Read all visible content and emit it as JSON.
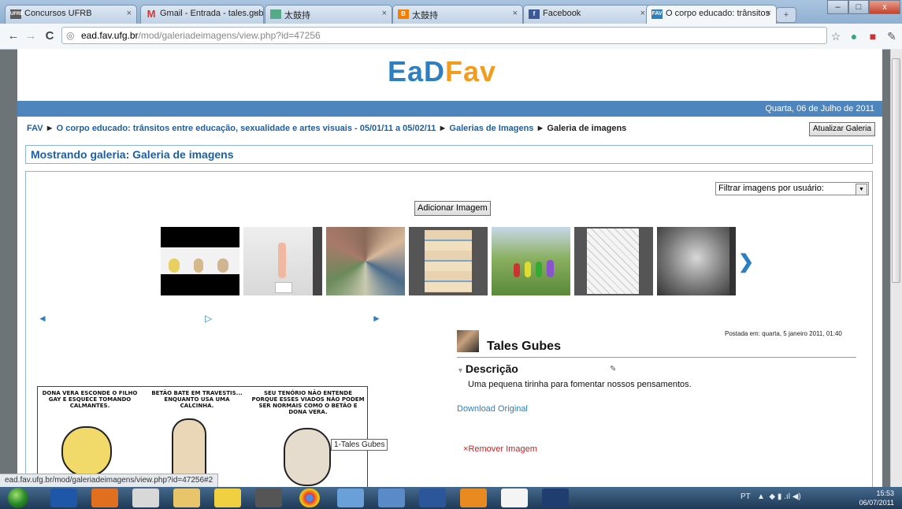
{
  "browser": {
    "tabs": [
      {
        "title": "Concursos UFRB",
        "icon": "ufrb-favicon",
        "active": false
      },
      {
        "title": "Gmail - Entrada - tales.gub",
        "icon": "gmail-favicon",
        "active": false
      },
      {
        "title": "太鼓持",
        "icon": "image-favicon",
        "active": false
      },
      {
        "title": "太鼓持",
        "icon": "blogger-favicon",
        "active": false
      },
      {
        "title": "Facebook",
        "icon": "facebook-favicon",
        "active": false
      },
      {
        "title": "O corpo educado: trânsitos",
        "icon": "fav-favicon",
        "active": true
      }
    ],
    "url_host": "ead.fav.ufg.br",
    "url_path": "/mod/galeriadeimagens/view.php?id=47256",
    "status_url": "ead.fav.ufg.br/mod/galeriadeimagens/view.php?id=47256#2"
  },
  "page": {
    "logo_left": "EaD",
    "logo_right": "Fav",
    "date": "Quarta, 06 de Julho de 2011",
    "breadcrumb": {
      "root": "FAV",
      "course": "O corpo educado: trânsitos entre educação, sexualidade e artes visuais - 05/01/11 a 05/02/11",
      "galleries": "Galerias de Imagens",
      "current": "Galeria de imagens",
      "separator": "►"
    },
    "update_button": "Atualizar Galeria",
    "heading": "Mostrando galeria: Galeria de imagens",
    "filter_select": "Filtrar imagens por usuário:",
    "add_image_button": "Adicionar Imagem",
    "thumbnails": [
      "comic-strip",
      "sculpture",
      "photo-collage",
      "comic-page",
      "teletubbies",
      "sketch-page",
      "drawing"
    ],
    "controls": {
      "prev": "◄",
      "play": "▷",
      "next": "►",
      "carousel_next": "❯"
    },
    "detail": {
      "author": "Tales Gubes",
      "posted": "Postada em: quarta, 5 janeiro 2011, 01:40",
      "description_title": "Descrição",
      "description_text": "Uma pequena tirinha para fomentar nossos pensamentos.",
      "download": "Download Original",
      "remove": "Remover Imagem",
      "remove_icon": "×"
    },
    "comic": {
      "panel1": "DONA VERA ESCONDE O FILHO GAY E ESQUECE TOMANDO CALMANTES.",
      "panel2": "BETÃO BATE EM TRAVESTIS... ENQUANTO USA UMA CALCINHA.",
      "panel3": "SEU TENÓRIO NÃO ENTENDE PORQUE ESSES VIADOS NÃO PODEM SER NORMAIS COMO O BETÃO E DONA VERA."
    },
    "tooltip": "1-Tales Gubes"
  },
  "taskbar": {
    "lang": "PT",
    "time": "15:53",
    "date": "06/07/2011"
  },
  "colors": {
    "accent": "#2d7fc0",
    "band": "#4f85bd",
    "logo_orange": "#f29c1f"
  }
}
